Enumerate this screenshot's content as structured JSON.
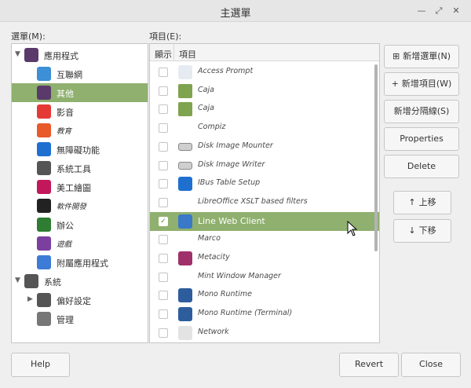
{
  "window": {
    "title": "主選單",
    "controls": [
      "—",
      "⤢",
      "✕"
    ]
  },
  "menus_label": "選單(M):",
  "items_label": "項目(E):",
  "menu_tree": [
    {
      "label": "應用程式",
      "level": 0,
      "expanded": true,
      "icon": "apps-grid-icon",
      "color": "#5a3a6a"
    },
    {
      "label": "互聯網",
      "level": 1,
      "icon": "cloud-icon",
      "color": "#3d8fd6"
    },
    {
      "label": "其他",
      "level": 1,
      "icon": "grid-icon",
      "color": "#5a3a6a",
      "selected": true
    },
    {
      "label": "影音",
      "level": 1,
      "icon": "play-icon",
      "color": "#e53935"
    },
    {
      "label": "教育",
      "level": 1,
      "icon": "education-icon",
      "color": "#e85a2a",
      "italic": true
    },
    {
      "label": "無障礙功能",
      "level": 1,
      "icon": "accessibility-icon",
      "color": "#1f6fd1"
    },
    {
      "label": "系統工具",
      "level": 1,
      "icon": "system-tools-icon",
      "color": "#555555"
    },
    {
      "label": "美工繪圖",
      "level": 1,
      "icon": "graphics-icon",
      "color": "#c2185b"
    },
    {
      "label": "軟件開發",
      "level": 1,
      "icon": "development-icon",
      "color": "#222222",
      "italic": true
    },
    {
      "label": "辦公",
      "level": 1,
      "icon": "office-icon",
      "color": "#2e7d32"
    },
    {
      "label": "遊戲",
      "level": 1,
      "icon": "games-icon",
      "color": "#7b3fa0",
      "italic": true
    },
    {
      "label": "附屬應用程式",
      "level": 1,
      "icon": "accessories-icon",
      "color": "#3d7bd6"
    },
    {
      "label": "系統",
      "level": 0,
      "expanded": true,
      "icon": "gear-icon",
      "color": "#555555"
    },
    {
      "label": "偏好設定",
      "level": 1,
      "collapsed": true,
      "icon": "preferences-icon",
      "color": "#555555"
    },
    {
      "label": "管理",
      "level": 1,
      "icon": "administration-icon",
      "color": "#777777"
    }
  ],
  "columns": {
    "show": "顯示",
    "item": "項目"
  },
  "items": [
    {
      "label": "Access Prompt",
      "checked": false,
      "icon": "key-icon"
    },
    {
      "label": "Caja",
      "checked": false,
      "icon": "folder-icon"
    },
    {
      "label": "Caja",
      "checked": false,
      "icon": "folder-icon"
    },
    {
      "label": "Compiz",
      "checked": false,
      "icon": ""
    },
    {
      "label": "Disk Image Mounter",
      "checked": false,
      "icon": "drive-icon"
    },
    {
      "label": "Disk Image Writer",
      "checked": false,
      "icon": "drive-icon"
    },
    {
      "label": "IBus Table Setup",
      "checked": false,
      "icon": "ibus-icon"
    },
    {
      "label": "LibreOffice XSLT based filters",
      "checked": false,
      "icon": ""
    },
    {
      "label": "Line Web Client",
      "checked": true,
      "icon": "browser-icon",
      "selected": true
    },
    {
      "label": "Marco",
      "checked": false,
      "icon": ""
    },
    {
      "label": "Metacity",
      "checked": false,
      "icon": "metacity-icon"
    },
    {
      "label": "Mint Window Manager",
      "checked": false,
      "icon": ""
    },
    {
      "label": "Mono Runtime",
      "checked": false,
      "icon": "mono-icon"
    },
    {
      "label": "Mono Runtime (Terminal)",
      "checked": false,
      "icon": "mono-icon"
    },
    {
      "label": "Network",
      "checked": false,
      "icon": "network-icon"
    }
  ],
  "buttons": {
    "new_menu": "新增選單(N)",
    "new_item": "新增項目(W)",
    "new_separator": "新增分隔線(S)",
    "properties": "Properties",
    "delete": "Delete",
    "move_up": "上移",
    "move_down": "下移",
    "help": "Help",
    "revert": "Revert",
    "close": "Close"
  },
  "colors": {
    "selection": "#8fb06e",
    "panel_bg": "#ffffff",
    "window_bg": "#efefef"
  }
}
